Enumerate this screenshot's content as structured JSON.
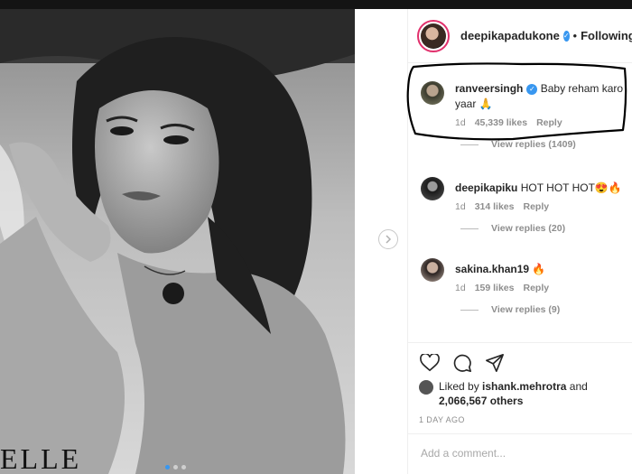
{
  "post": {
    "author": "deepikapadukone",
    "follow_status": "Following",
    "watermark": "ELLE",
    "carousel": {
      "total": 3,
      "current": 1
    }
  },
  "comments": [
    {
      "user": "ranveersingh",
      "verified": true,
      "text": "Baby reham karo yaar 🙏",
      "age": "1d",
      "likes": "45,339 likes",
      "reply": "Reply",
      "view_replies": "View replies (1409)"
    },
    {
      "user": "deepikapiku",
      "verified": false,
      "text": "HOT HOT HOT😍🔥",
      "age": "1d",
      "likes": "314 likes",
      "reply": "Reply",
      "view_replies": "View replies (20)"
    },
    {
      "user": "sakina.khan19",
      "verified": false,
      "text": "🔥",
      "age": "1d",
      "likes": "159 likes",
      "reply": "Reply",
      "view_replies": "View replies (9)"
    }
  ],
  "likes": {
    "prefix": "Liked by",
    "user": "ishank.mehrotra",
    "joiner": "and",
    "others": "2,066,567 others"
  },
  "timestamp": "1 DAY AGO",
  "add_comment": {
    "placeholder": "Add a comment..."
  },
  "colors": {
    "verified": "#3897f0",
    "highlight_ink": "#000000",
    "text": "#262626",
    "muted": "#8e8e8e"
  },
  "icons": [
    "next-arrow-icon",
    "heart-icon",
    "comment-icon",
    "share-icon",
    "verified-icon"
  ]
}
